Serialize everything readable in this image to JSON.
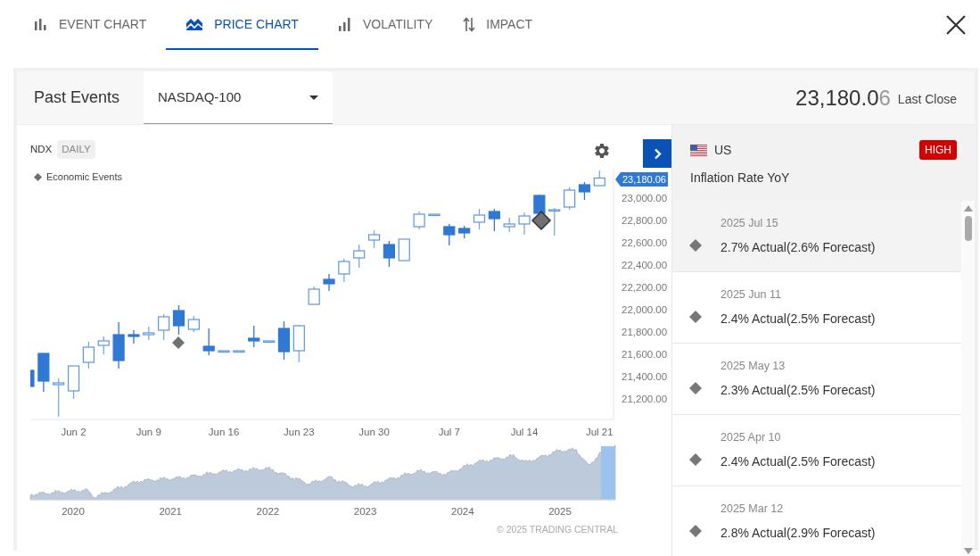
{
  "tabs": [
    {
      "label": "EVENT CHART",
      "kind": "bars",
      "selected": false
    },
    {
      "label": "PRICE CHART",
      "kind": "mountain",
      "selected": true
    },
    {
      "label": "VOLATILITY",
      "kind": "signal",
      "selected": false
    },
    {
      "label": "IMPACT",
      "kind": "arrows",
      "selected": false
    }
  ],
  "past_events": {
    "title": "Past Events",
    "instrument_select": {
      "value": "NASDAQ-100"
    },
    "last_close": {
      "price": "23,180.0",
      "price_tail": "6",
      "label": "Last Close"
    }
  },
  "chart": {
    "symbol": "NDX",
    "interval": "DAILY",
    "legend": "Economic Events",
    "last_price_tag": "23,180.06",
    "chart_data": {
      "type": "candlestick",
      "categories": [
        null,
        null,
        null,
        "Jun 2",
        null,
        null,
        null,
        null,
        "Jun 9",
        null,
        null,
        null,
        null,
        "Jun 16",
        null,
        null,
        null,
        null,
        "Jun 23",
        null,
        null,
        null,
        null,
        "Jun 30",
        null,
        null,
        null,
        null,
        "Jul 7",
        null,
        null,
        null,
        null,
        "Jul 14",
        null,
        null,
        null,
        null,
        "Jul 21"
      ],
      "ylim": [
        21016,
        23264
      ],
      "ohlc": [
        [
          21456,
          21456,
          21312,
          21312
        ],
        [
          21608,
          21608,
          21264,
          21360
        ],
        [
          21328,
          21384,
          21040,
          21344
        ],
        [
          21272,
          21496,
          21200,
          21496
        ],
        [
          21528,
          21712,
          21472,
          21664
        ],
        [
          21680,
          21760,
          21600,
          21720
        ],
        [
          21776,
          21888,
          21472,
          21544
        ],
        [
          21776,
          21816,
          21696,
          21760
        ],
        [
          21776,
          21848,
          21728,
          21792
        ],
        [
          21816,
          21960,
          21728,
          21936
        ],
        [
          21992,
          22040,
          21776,
          21856
        ],
        [
          21824,
          21944,
          21800,
          21912
        ],
        [
          21672,
          21832,
          21592,
          21632
        ],
        [
          21632,
          21632,
          21632,
          21632
        ],
        [
          21632,
          21632,
          21632,
          21632
        ],
        [
          21744,
          21856,
          21664,
          21720
        ],
        [
          21720,
          21720,
          21720,
          21720
        ],
        [
          21832,
          21896,
          21552,
          21624
        ],
        [
          21632,
          21864,
          21528,
          21856
        ],
        [
          22048,
          22208,
          22048,
          22184
        ],
        [
          22272,
          22320,
          22168,
          22232
        ],
        [
          22320,
          22456,
          22248,
          22432
        ],
        [
          22464,
          22584,
          22376,
          22528
        ],
        [
          22624,
          22712,
          22552,
          22672
        ],
        [
          22584,
          22616,
          22384,
          22464
        ],
        [
          22440,
          22632,
          22440,
          22632
        ],
        [
          22744,
          22880,
          22720,
          22856
        ],
        [
          22856,
          22856,
          22856,
          22856
        ],
        [
          22744,
          22768,
          22576,
          22672
        ],
        [
          22728,
          22752,
          22640,
          22688
        ],
        [
          22784,
          22904,
          22720,
          22848
        ],
        [
          22880,
          22904,
          22704,
          22816
        ],
        [
          22744,
          22824,
          22696,
          22768
        ],
        [
          22768,
          22872,
          22672,
          22840
        ],
        [
          23024,
          23032,
          22864,
          22864
        ],
        [
          22888,
          22912,
          22664,
          22896
        ],
        [
          22920,
          23096,
          22896,
          23072
        ],
        [
          23120,
          23144,
          22984,
          23056
        ],
        [
          23112,
          23248,
          23112,
          23180
        ]
      ],
      "yticks": [
        {
          "value": 23000,
          "label": "23,000.00"
        },
        {
          "value": 22800,
          "label": "22,800.00"
        },
        {
          "value": 22600,
          "label": "22,600.00"
        },
        {
          "value": 22400,
          "label": "22,400.00"
        },
        {
          "value": 22200,
          "label": "22,200.00"
        },
        {
          "value": 22000,
          "label": "22,000.00"
        },
        {
          "value": 21800,
          "label": "21,800.00"
        },
        {
          "value": 21600,
          "label": "21,600.00"
        },
        {
          "value": 21400,
          "label": "21,400.00"
        },
        {
          "value": 21200,
          "label": "21,200.00"
        }
      ]
    },
    "navigator_labels": [
      "2020",
      "2021",
      "2022",
      "2023",
      "2024",
      "2025"
    ],
    "copyright": "© 2025 TRADING CENTRAL"
  },
  "event": {
    "country": "US",
    "importance": "HIGH",
    "name": "Inflation Rate YoY",
    "releases": [
      {
        "date": "2025 Jul 15",
        "result": "2.7% Actual(2.6% Forecast)",
        "selected": true
      },
      {
        "date": "2025 Jun 11",
        "result": "2.4% Actual(2.5% Forecast)",
        "selected": false
      },
      {
        "date": "2025 May 13",
        "result": "2.3% Actual(2.5% Forecast)",
        "selected": false
      },
      {
        "date": "2025 Apr 10",
        "result": "2.4% Actual(2.5% Forecast)",
        "selected": false
      },
      {
        "date": "2025 Mar 12",
        "result": "2.8% Actual(2.9% Forecast)",
        "selected": false
      }
    ]
  }
}
